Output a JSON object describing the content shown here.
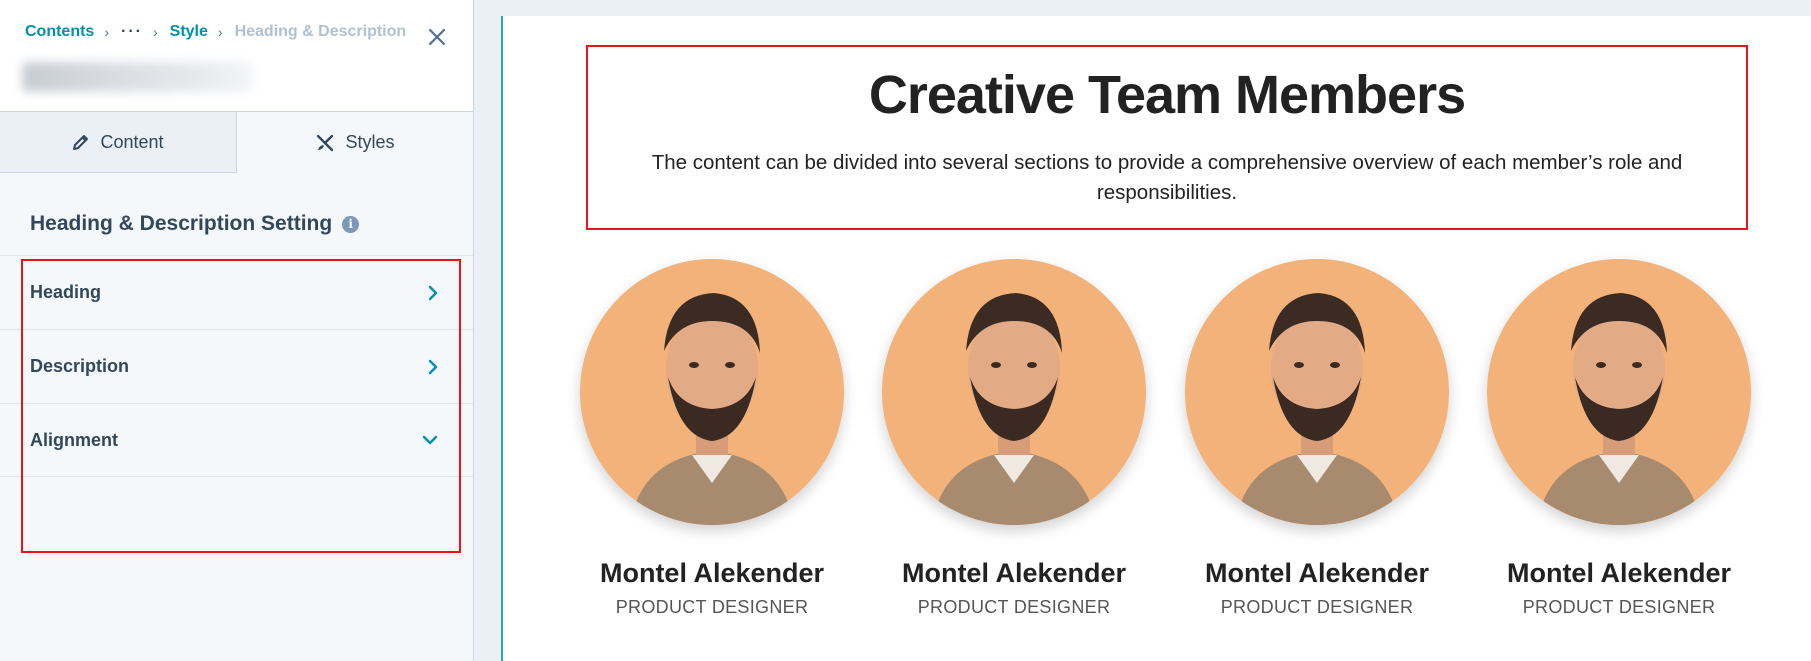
{
  "breadcrumb": {
    "contents": "Contents",
    "ellipsis": "···",
    "style": "Style",
    "current": "Heading & Description"
  },
  "tabs": [
    {
      "label": "Content",
      "icon": "pencil-icon"
    },
    {
      "label": "Styles",
      "icon": "brush-icon"
    }
  ],
  "settings": {
    "title": "Heading & Description Setting",
    "info_icon": "i",
    "rows": [
      {
        "label": "Heading",
        "icon": "chevron-right-icon"
      },
      {
        "label": "Description",
        "icon": "chevron-right-icon"
      },
      {
        "label": "Alignment",
        "icon": "chevron-down-icon"
      }
    ]
  },
  "preview": {
    "title": "Creative Team Members",
    "description": "The content can be divided into several sections to provide a comprehensive overview of each member’s role and responsibilities.",
    "members": [
      {
        "name": "Montel Alekender",
        "role": "PRODUCT DESIGNER"
      },
      {
        "name": "Montel Alekender",
        "role": "PRODUCT DESIGNER"
      },
      {
        "name": "Montel Alekender",
        "role": "PRODUCT DESIGNER"
      },
      {
        "name": "Montel Alekender",
        "role": "PRODUCT DESIGNER"
      }
    ]
  },
  "colors": {
    "accent": "#0091ae",
    "highlight": "#e8131b",
    "avatar_bg": "#f2b27a"
  }
}
